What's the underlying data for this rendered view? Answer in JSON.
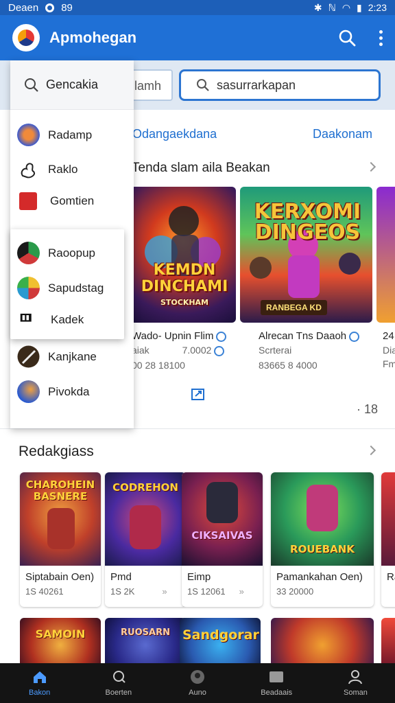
{
  "status_bar": {
    "carrier": "Deaen",
    "signal_text": "89",
    "time": "2:23"
  },
  "app_bar": {
    "title": "Apmohegan",
    "search_icon": "search-icon",
    "menu_icon": "more-vert-icon"
  },
  "search": {
    "chip_text": "lamh",
    "value": "sasurrarkapan"
  },
  "drawer": {
    "search_label": "Gencakia",
    "items": [
      {
        "label": "Radamp"
      },
      {
        "label": "Raklo"
      },
      {
        "label": "Gomtien"
      },
      {
        "label": "Kanjkane"
      },
      {
        "label": "Pivokda"
      }
    ],
    "submenu_items": [
      {
        "label": "Raoopup"
      },
      {
        "label": "Sapudstag"
      },
      {
        "label": "Kadek"
      }
    ]
  },
  "main": {
    "links": {
      "left": "Odangaekdana",
      "right": "Daakonam"
    },
    "section1_title": "Tenda slam aila Beakan",
    "featured": [
      {
        "art_title": "KEMDN DINCHAMI",
        "art_sub": "STOCKHAM",
        "name": "Wado- Upnin Flim",
        "sub": "aiak",
        "extra": "7.0002",
        "meta": "00 28 18100"
      },
      {
        "art_title": "KERXOMI DINGEOS",
        "badge": "RANBEGA KD",
        "name": "Alrecan Tns Daaoh",
        "sub": "Scrterai",
        "meta": "83665 8 4000"
      },
      {
        "art_title": "",
        "name": "24",
        "sub": "Dia",
        "meta": "Fm"
      }
    ],
    "page_indicator": "· 18",
    "section2_title": "Redakgiass",
    "grid": [
      {
        "art_title": "CHAROHEIN BASNERE",
        "name": "Siptabain Oen)",
        "meta": "1S 40261"
      },
      {
        "art_title": "CODREHON",
        "name": "Pmd",
        "meta": "1S 2K"
      },
      {
        "art_title": "CIKSAIVAS",
        "name": "Eimp",
        "meta": "1S 12061"
      },
      {
        "art_title": "ROUEBANK",
        "name": "Pamankahan Oen)",
        "meta": "33 20000"
      },
      {
        "art_title": "",
        "name": "Ra",
        "meta": ""
      }
    ],
    "row3": [
      {
        "art_title": "SAMOIN"
      },
      {
        "art_title": "RUOSARN"
      },
      {
        "art_title": "Sandgorar"
      },
      {
        "art_title": ""
      },
      {
        "art_title": ""
      }
    ]
  },
  "bottom_nav": [
    {
      "label": "Bakon",
      "icon": "home-icon",
      "active": true
    },
    {
      "label": "Boerten",
      "icon": "search-icon",
      "active": false
    },
    {
      "label": "Auno",
      "icon": "avatar-icon",
      "active": false
    },
    {
      "label": "Beadaais",
      "icon": "library-icon",
      "active": false
    },
    {
      "label": "Soman",
      "icon": "profile-icon",
      "active": false
    }
  ],
  "colors": {
    "primary": "#1f70d6",
    "status_bar": "#1d5fb8",
    "accent_link": "#1f6fd0",
    "nav_bg": "#141414",
    "nav_active": "#4c9bff"
  }
}
